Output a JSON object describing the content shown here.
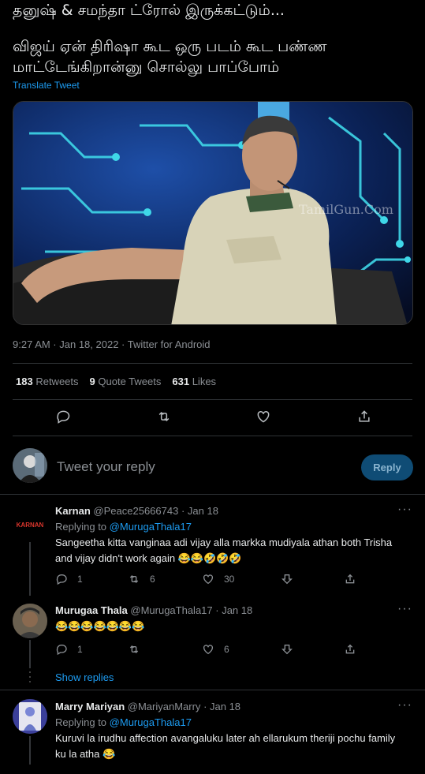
{
  "tweet": {
    "line1": "தனுஷ் & சமந்தா ட்ரோல் இருக்கட்டும்...",
    "line2": "விஜய் ஏன் திரிஷா கூட ஒரு படம் கூட பண்ண",
    "line3": "மாட்டேங்கிறான்னு சொல்லு பாப்போம்",
    "translate_label": "Translate Tweet",
    "media_watermark": "TamilGun.Com",
    "timestamp": "9:27 AM · Jan 18, 2022 · Twitter for Android"
  },
  "stats": {
    "retweets_count": "183",
    "retweets_label": "Retweets",
    "quotes_count": "9",
    "quotes_label": "Quote Tweets",
    "likes_count": "631",
    "likes_label": "Likes"
  },
  "reply_composer": {
    "placeholder": "Tweet your reply",
    "button_label": "Reply"
  },
  "replies": [
    {
      "name": "Karnan",
      "handle": "@Peace25666743",
      "date": "· Jan 18",
      "avatar_text": "KARNAN",
      "replying_label": "Replying to",
      "mention": "@MurugaThala17",
      "body_line1": "Sangeetha kitta vanginaa adi vijay alla markka mudiyala athan both Trisha",
      "body_line2": "and vijay didn't work again 😂😂🤣🤣🤣",
      "reply_count": "1",
      "retweet_count": "6",
      "like_count": "30"
    },
    {
      "name": "Murugaa Thala",
      "handle": "@MurugaThala17",
      "date": "· Jan 18",
      "body_line1": "😂😂😂😂😂😂😂",
      "reply_count": "1",
      "retweet_count": "",
      "like_count": "6",
      "show_replies": "Show replies"
    },
    {
      "name": "Marry Mariyan",
      "handle": "@MariyanMarry",
      "date": "· Jan 18",
      "replying_label": "Replying to",
      "mention": "@MurugaThala17",
      "body_line1": "Kuruvi la irudhu affection avangaluku later ah ellarukum theriji pochu family",
      "body_line2": "ku la atha 😂"
    }
  ],
  "icons": [
    "reply-icon",
    "retweet-icon",
    "like-icon",
    "share-icon",
    "more-icon",
    "vote-down-icon"
  ],
  "colors": {
    "accent": "#1d9bf0",
    "background": "#000000",
    "muted": "#8b8f94",
    "reply_button": "#0f4c75"
  }
}
